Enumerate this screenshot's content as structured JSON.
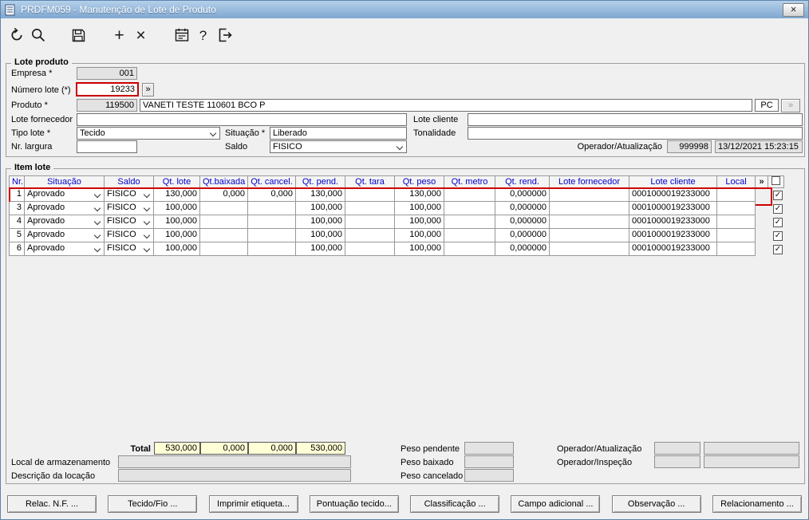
{
  "window": {
    "title": "PRDFM059 - Manutenção de Lote de Produto",
    "close": "×"
  },
  "toolbar": {
    "plus": "+",
    "delete": "×",
    "help": "?"
  },
  "lote_produto": {
    "legend": "Lote produto",
    "empresa": {
      "label": "Empresa *",
      "value": "001"
    },
    "numero_lote": {
      "label": "Número lote (*)",
      "value": "19233",
      "expand": "»"
    },
    "produto": {
      "label": "Produto *",
      "code": "119500",
      "descricao": "VANETI TESTE 110601 BCO P",
      "unidade": "PC",
      "expand": "»"
    },
    "lote_fornecedor": {
      "label": "Lote fornecedor",
      "value": ""
    },
    "lote_cliente": {
      "label": "Lote cliente",
      "value": ""
    },
    "tipo_lote": {
      "label": "Tipo lote *",
      "value": "Tecido"
    },
    "situacao": {
      "label": "Situação *",
      "value": "Liberado"
    },
    "tonalidade": {
      "label": "Tonalidade",
      "value": ""
    },
    "nr_largura": {
      "label": "Nr. largura",
      "value": ""
    },
    "saldo": {
      "label": "Saldo",
      "value": "FISICO"
    },
    "operador_atualizacao": {
      "label": "Operador/Atualização",
      "codigo": "999998",
      "data_hora": "13/12/2021 15:23:15"
    }
  },
  "item_lote": {
    "legend": "Item lote",
    "more_label": "»",
    "columns": [
      "Nr.",
      "Situação",
      "Saldo",
      "Qt. lote",
      "Qt.baixada",
      "Qt. cancel.",
      "Qt. pend.",
      "Qt. tara",
      "Qt. peso",
      "Qt. metro",
      "Qt. rend.",
      "Lote fornecedor",
      "Lote cliente",
      "Local"
    ],
    "rows": [
      {
        "cells": [
          "1",
          "Aprovado",
          "FISICO",
          "130,000",
          "0,000",
          "0,000",
          "130,000",
          "",
          "130,000",
          "",
          "0,000000",
          "",
          "0001000019233000",
          ""
        ],
        "checked": true,
        "highlighted": true
      },
      {
        "cells": [
          "3",
          "Aprovado",
          "FISICO",
          "100,000",
          "",
          "",
          "100,000",
          "",
          "100,000",
          "",
          "0,000000",
          "",
          "0001000019233000",
          ""
        ],
        "checked": true,
        "highlighted": false
      },
      {
        "cells": [
          "4",
          "Aprovado",
          "FISICO",
          "100,000",
          "",
          "",
          "100,000",
          "",
          "100,000",
          "",
          "0,000000",
          "",
          "0001000019233000",
          ""
        ],
        "checked": true,
        "highlighted": false
      },
      {
        "cells": [
          "5",
          "Aprovado",
          "FISICO",
          "100,000",
          "",
          "",
          "100,000",
          "",
          "100,000",
          "",
          "0,000000",
          "",
          "0001000019233000",
          ""
        ],
        "checked": true,
        "highlighted": false
      },
      {
        "cells": [
          "6",
          "Aprovado",
          "FISICO",
          "100,000",
          "",
          "",
          "100,000",
          "",
          "100,000",
          "",
          "0,000000",
          "",
          "0001000019233000",
          ""
        ],
        "checked": true,
        "highlighted": false
      }
    ],
    "totais": {
      "label": "Total",
      "qt_lote": "530,000",
      "qt_baixada": "0,000",
      "qt_cancel": "0,000",
      "qt_pend": "530,000"
    },
    "local_armazenamento": {
      "label": "Local de armazenamento",
      "value": ""
    },
    "descricao_locacao": {
      "label": "Descrição da locação",
      "value": ""
    },
    "peso_pendente": {
      "label": "Peso pendente",
      "value": ""
    },
    "peso_baixado": {
      "label": "Peso baixado",
      "value": ""
    },
    "peso_cancelado": {
      "label": "Peso cancelado",
      "value": ""
    },
    "operador_atualizacao": {
      "label": "Operador/Atualização",
      "v1": "",
      "v2": ""
    },
    "operador_inspecao": {
      "label": "Operador/Inspeção",
      "v1": "",
      "v2": ""
    }
  },
  "footer_buttons": [
    "Relac. N.F. ...",
    "Tecido/Fio ...",
    "Imprimir etiqueta...",
    "Pontuação tecido...",
    "Classificação ...",
    "Campo adicional ...",
    "Observação ...",
    "Relacionamento ..."
  ]
}
